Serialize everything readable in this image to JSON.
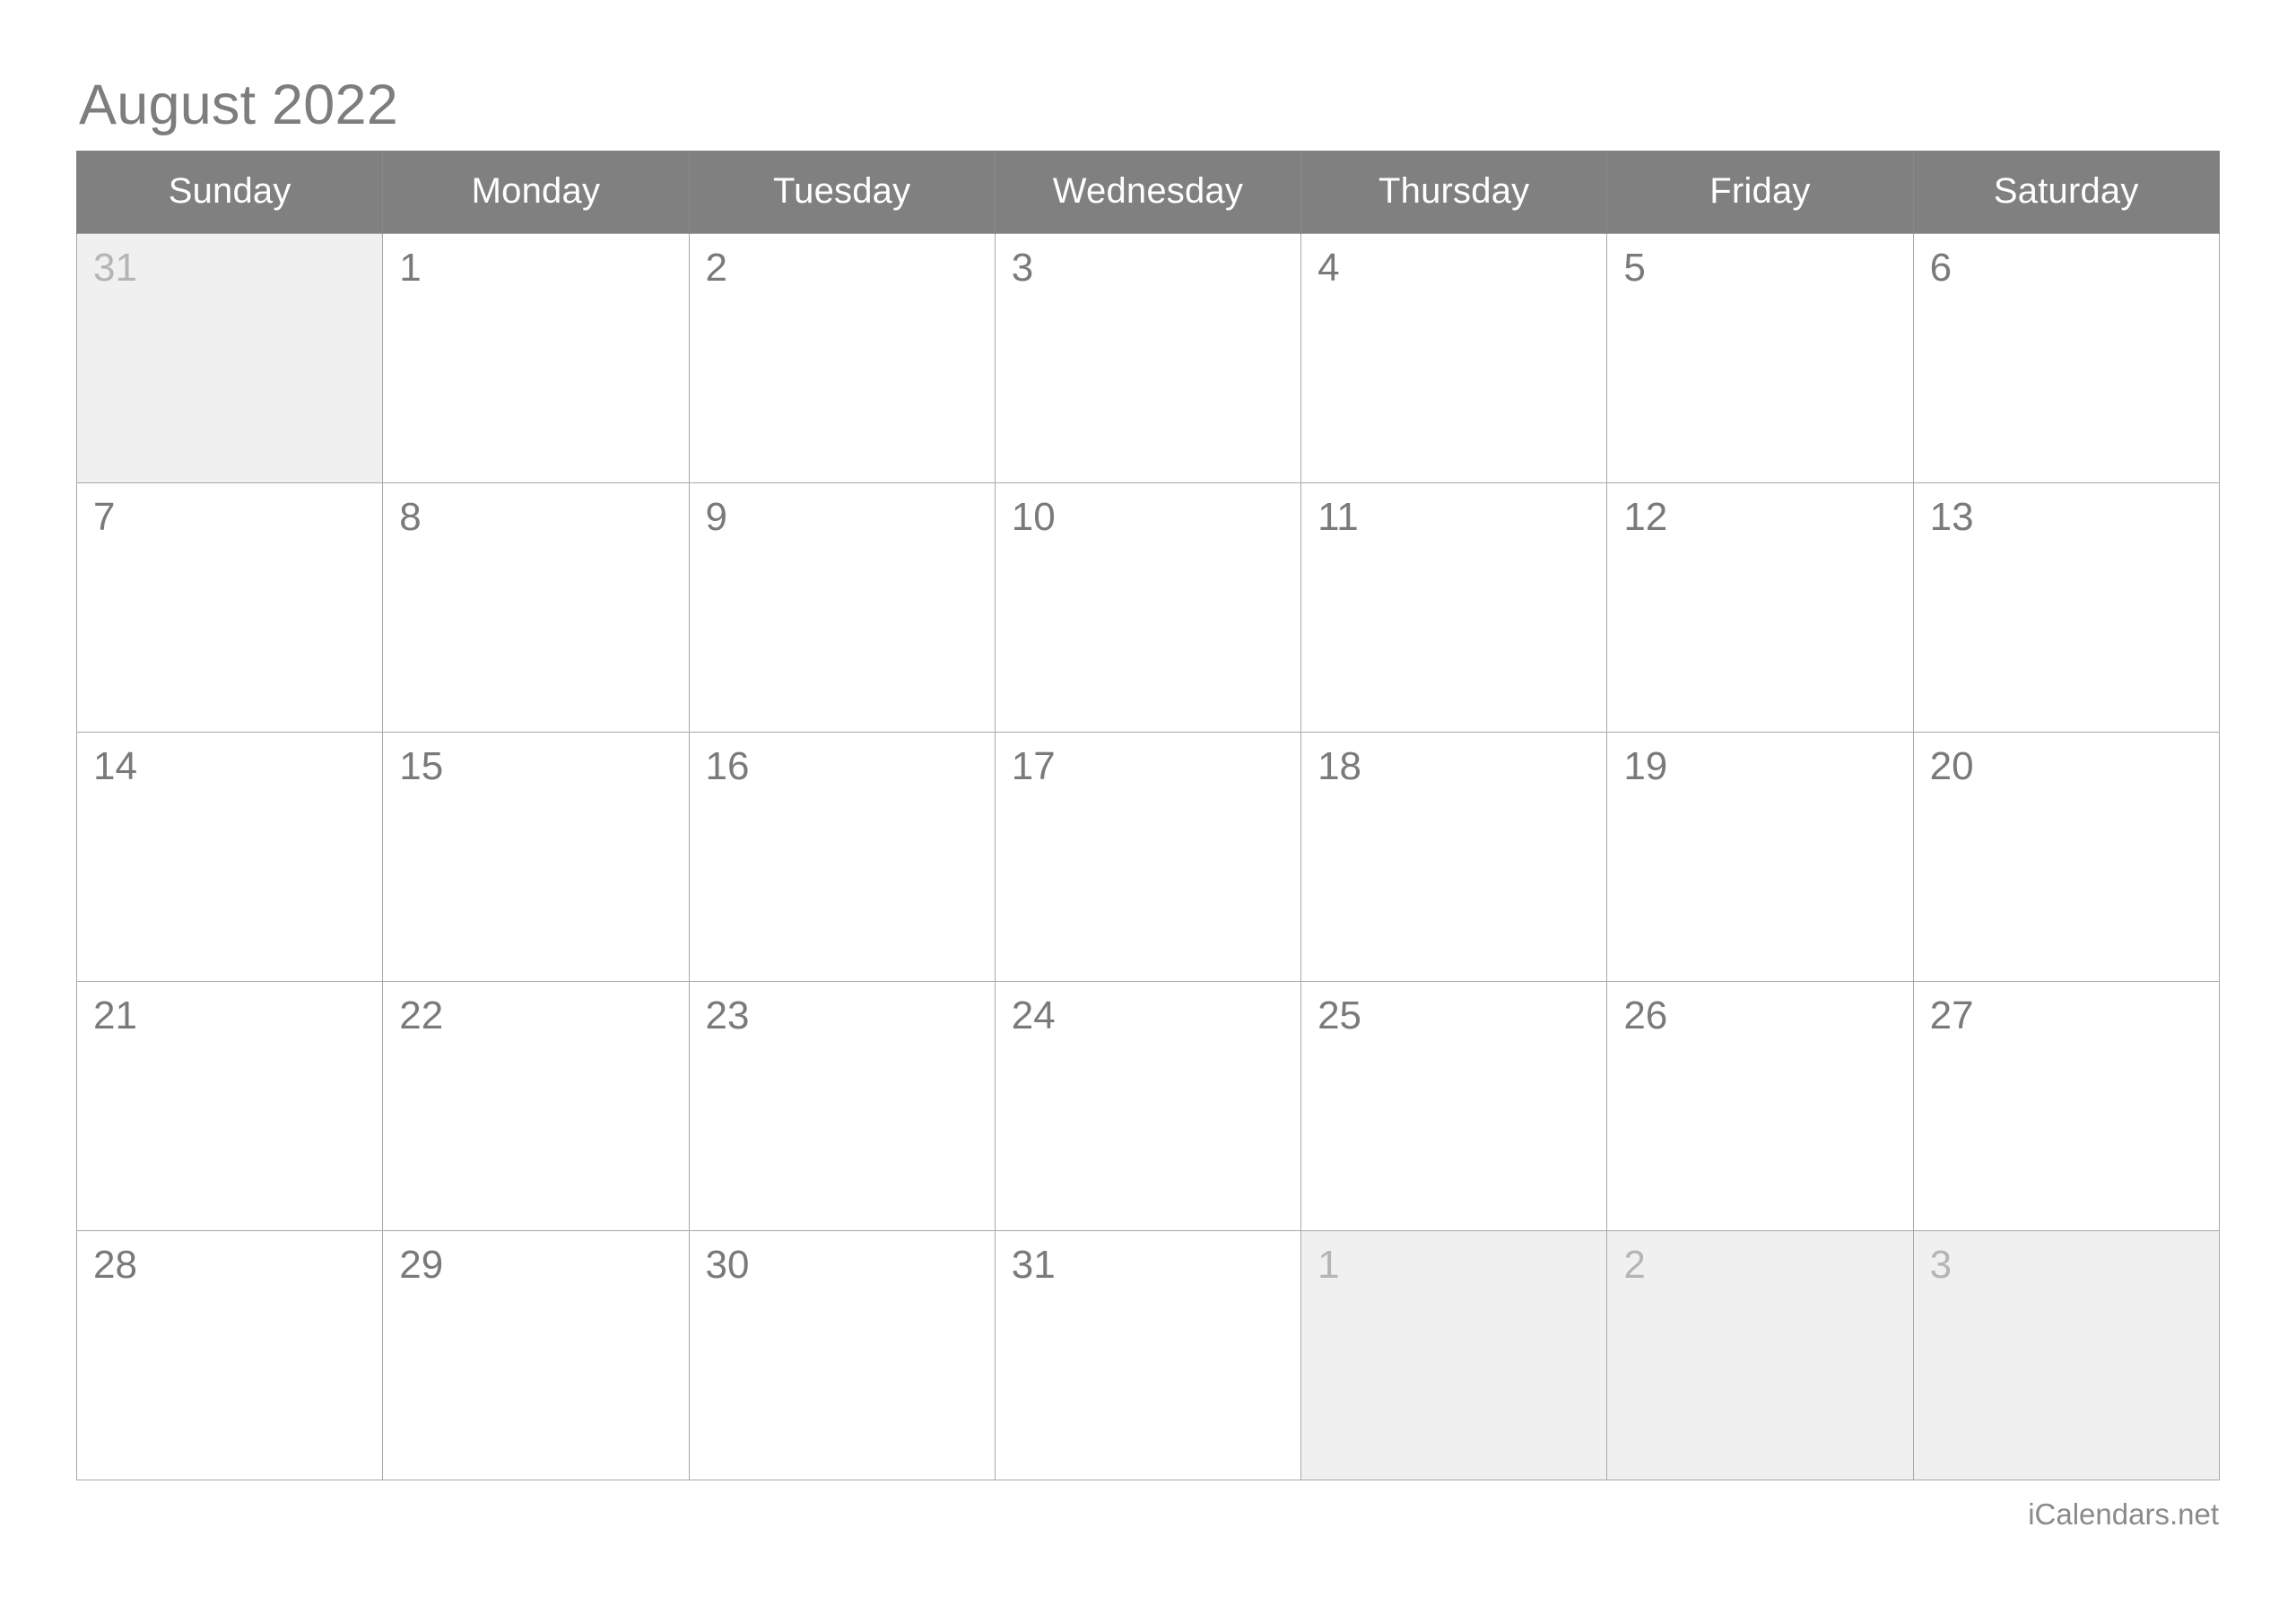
{
  "title": "August 2022",
  "colors": {
    "header_bg": "#808080",
    "header_text": "#ffffff",
    "grid_line": "#a8a8a8",
    "day_number": "#7a7a7a",
    "other_month_bg": "#f0f0f0",
    "other_month_text": "#b5b5b5",
    "title_text": "#7d7d7d",
    "footer_text": "#8a8a8a"
  },
  "weekdays": [
    {
      "label": "Sunday"
    },
    {
      "label": "Monday"
    },
    {
      "label": "Tuesday"
    },
    {
      "label": "Wednesday"
    },
    {
      "label": "Thursday"
    },
    {
      "label": "Friday"
    },
    {
      "label": "Saturday"
    }
  ],
  "weeks": [
    [
      {
        "num": "31",
        "other": true
      },
      {
        "num": "1",
        "other": false
      },
      {
        "num": "2",
        "other": false
      },
      {
        "num": "3",
        "other": false
      },
      {
        "num": "4",
        "other": false
      },
      {
        "num": "5",
        "other": false
      },
      {
        "num": "6",
        "other": false
      }
    ],
    [
      {
        "num": "7",
        "other": false
      },
      {
        "num": "8",
        "other": false
      },
      {
        "num": "9",
        "other": false
      },
      {
        "num": "10",
        "other": false
      },
      {
        "num": "11",
        "other": false
      },
      {
        "num": "12",
        "other": false
      },
      {
        "num": "13",
        "other": false
      }
    ],
    [
      {
        "num": "14",
        "other": false
      },
      {
        "num": "15",
        "other": false
      },
      {
        "num": "16",
        "other": false
      },
      {
        "num": "17",
        "other": false
      },
      {
        "num": "18",
        "other": false
      },
      {
        "num": "19",
        "other": false
      },
      {
        "num": "20",
        "other": false
      }
    ],
    [
      {
        "num": "21",
        "other": false
      },
      {
        "num": "22",
        "other": false
      },
      {
        "num": "23",
        "other": false
      },
      {
        "num": "24",
        "other": false
      },
      {
        "num": "25",
        "other": false
      },
      {
        "num": "26",
        "other": false
      },
      {
        "num": "27",
        "other": false
      }
    ],
    [
      {
        "num": "28",
        "other": false
      },
      {
        "num": "29",
        "other": false
      },
      {
        "num": "30",
        "other": false
      },
      {
        "num": "31",
        "other": false
      },
      {
        "num": "1",
        "other": true
      },
      {
        "num": "2",
        "other": true
      },
      {
        "num": "3",
        "other": true
      }
    ]
  ],
  "footer": {
    "credit": "iCalendars.net"
  }
}
